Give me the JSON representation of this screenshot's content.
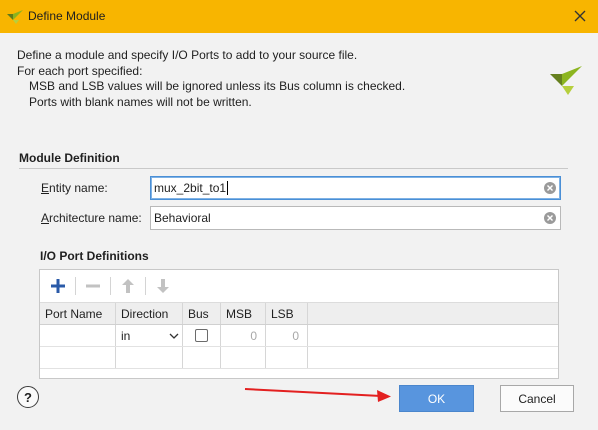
{
  "window": {
    "title": "Define Module"
  },
  "intro": {
    "line1": "Define a module and specify I/O Ports to add to your source file.",
    "line2": "For each port specified:",
    "line3": "MSB and LSB values will be ignored unless its Bus column is checked.",
    "line4": "Ports with blank names will not be written."
  },
  "module_definition": {
    "heading": "Module Definition",
    "entity": {
      "label_mnemonic": "E",
      "label_rest": "ntity name:",
      "value": "mux_2bit_to1"
    },
    "architecture": {
      "label_mnemonic": "A",
      "label_rest": "rchitecture name:",
      "value": "Behavioral"
    }
  },
  "io_ports": {
    "heading": "I/O Port Definitions",
    "toolbar": {
      "add_icon": "plus-icon",
      "remove_icon": "minus-icon",
      "up_icon": "arrow-up-icon",
      "down_icon": "arrow-down-icon"
    },
    "columns": [
      "Port Name",
      "Direction",
      "Bus",
      "MSB",
      "LSB"
    ],
    "rows": [
      {
        "port_name": "",
        "direction": "in",
        "bus": false,
        "msb": "0",
        "lsb": "0"
      }
    ]
  },
  "footer": {
    "help_label": "?",
    "ok_label": "OK",
    "cancel_label": "Cancel"
  },
  "colors": {
    "titlebar": "#f8b500",
    "ok_button": "#5895de",
    "annotation_arrow": "#e32020",
    "add_icon": "#2a5aa8"
  }
}
